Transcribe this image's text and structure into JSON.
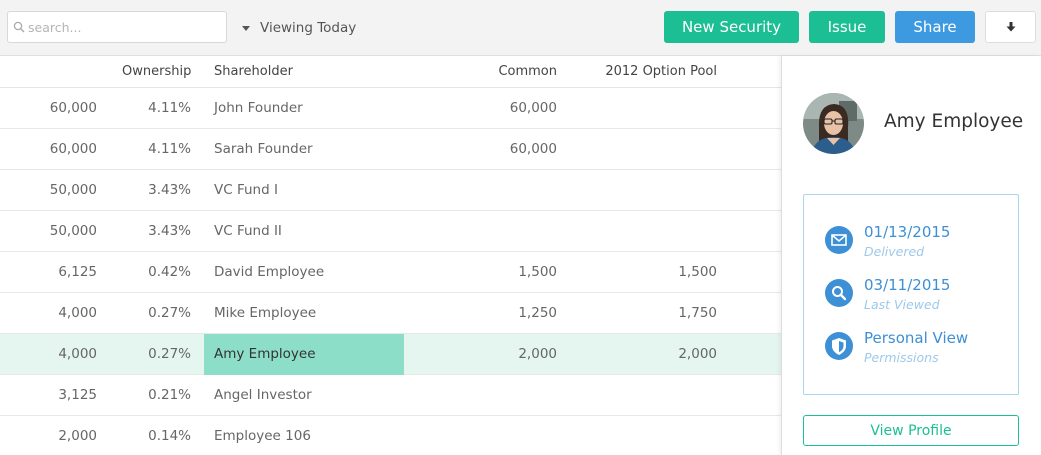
{
  "toolbar": {
    "search_placeholder": "search...",
    "viewing_label": "Viewing Today",
    "new_security_label": "New Security",
    "issue_label": "Issue",
    "share_label": "Share",
    "icons": {
      "search": "search-icon",
      "caret": "caret-down-icon",
      "download": "download-arrow-icon"
    },
    "colors": {
      "green": "#1bbf93",
      "blue": "#3d9ae0"
    }
  },
  "table": {
    "columns": [
      "Ownership",
      "Shareholder",
      "Common",
      "2012 Option Pool"
    ],
    "rows": [
      {
        "shares": "60,000",
        "ownership": "4.11%",
        "shareholder": "John Founder",
        "common": "60,000",
        "option_pool": ""
      },
      {
        "shares": "60,000",
        "ownership": "4.11%",
        "shareholder": "Sarah Founder",
        "common": "60,000",
        "option_pool": ""
      },
      {
        "shares": "50,000",
        "ownership": "3.43%",
        "shareholder": "VC Fund I",
        "common": "",
        "option_pool": ""
      },
      {
        "shares": "50,000",
        "ownership": "3.43%",
        "shareholder": "VC Fund II",
        "common": "",
        "option_pool": ""
      },
      {
        "shares": "6,125",
        "ownership": "0.42%",
        "shareholder": "David Employee",
        "common": "1,500",
        "option_pool": "1,500"
      },
      {
        "shares": "4,000",
        "ownership": "0.27%",
        "shareholder": "Mike Employee",
        "common": "1,250",
        "option_pool": "1,750"
      },
      {
        "shares": "4,000",
        "ownership": "0.27%",
        "shareholder": "Amy Employee",
        "common": "2,000",
        "option_pool": "2,000",
        "selected": true
      },
      {
        "shares": "3,125",
        "ownership": "0.21%",
        "shareholder": "Angel Investor",
        "common": "",
        "option_pool": ""
      },
      {
        "shares": "2,000",
        "ownership": "0.14%",
        "shareholder": "Employee 106",
        "common": "",
        "option_pool": ""
      }
    ]
  },
  "panel": {
    "name": "Amy Employee",
    "delivered_date": "01/13/2015",
    "delivered_label": "Delivered",
    "viewed_date": "03/11/2015",
    "viewed_label": "Last Viewed",
    "permission_value": "Personal View",
    "permission_label": "Permissions",
    "profile_button": "View Profile",
    "icons": {
      "mail": "envelope-icon",
      "view": "magnifier-icon",
      "permission": "shield-icon"
    },
    "colors": {
      "accent": "#3d8fd6",
      "muted": "#9ec9ea"
    }
  }
}
